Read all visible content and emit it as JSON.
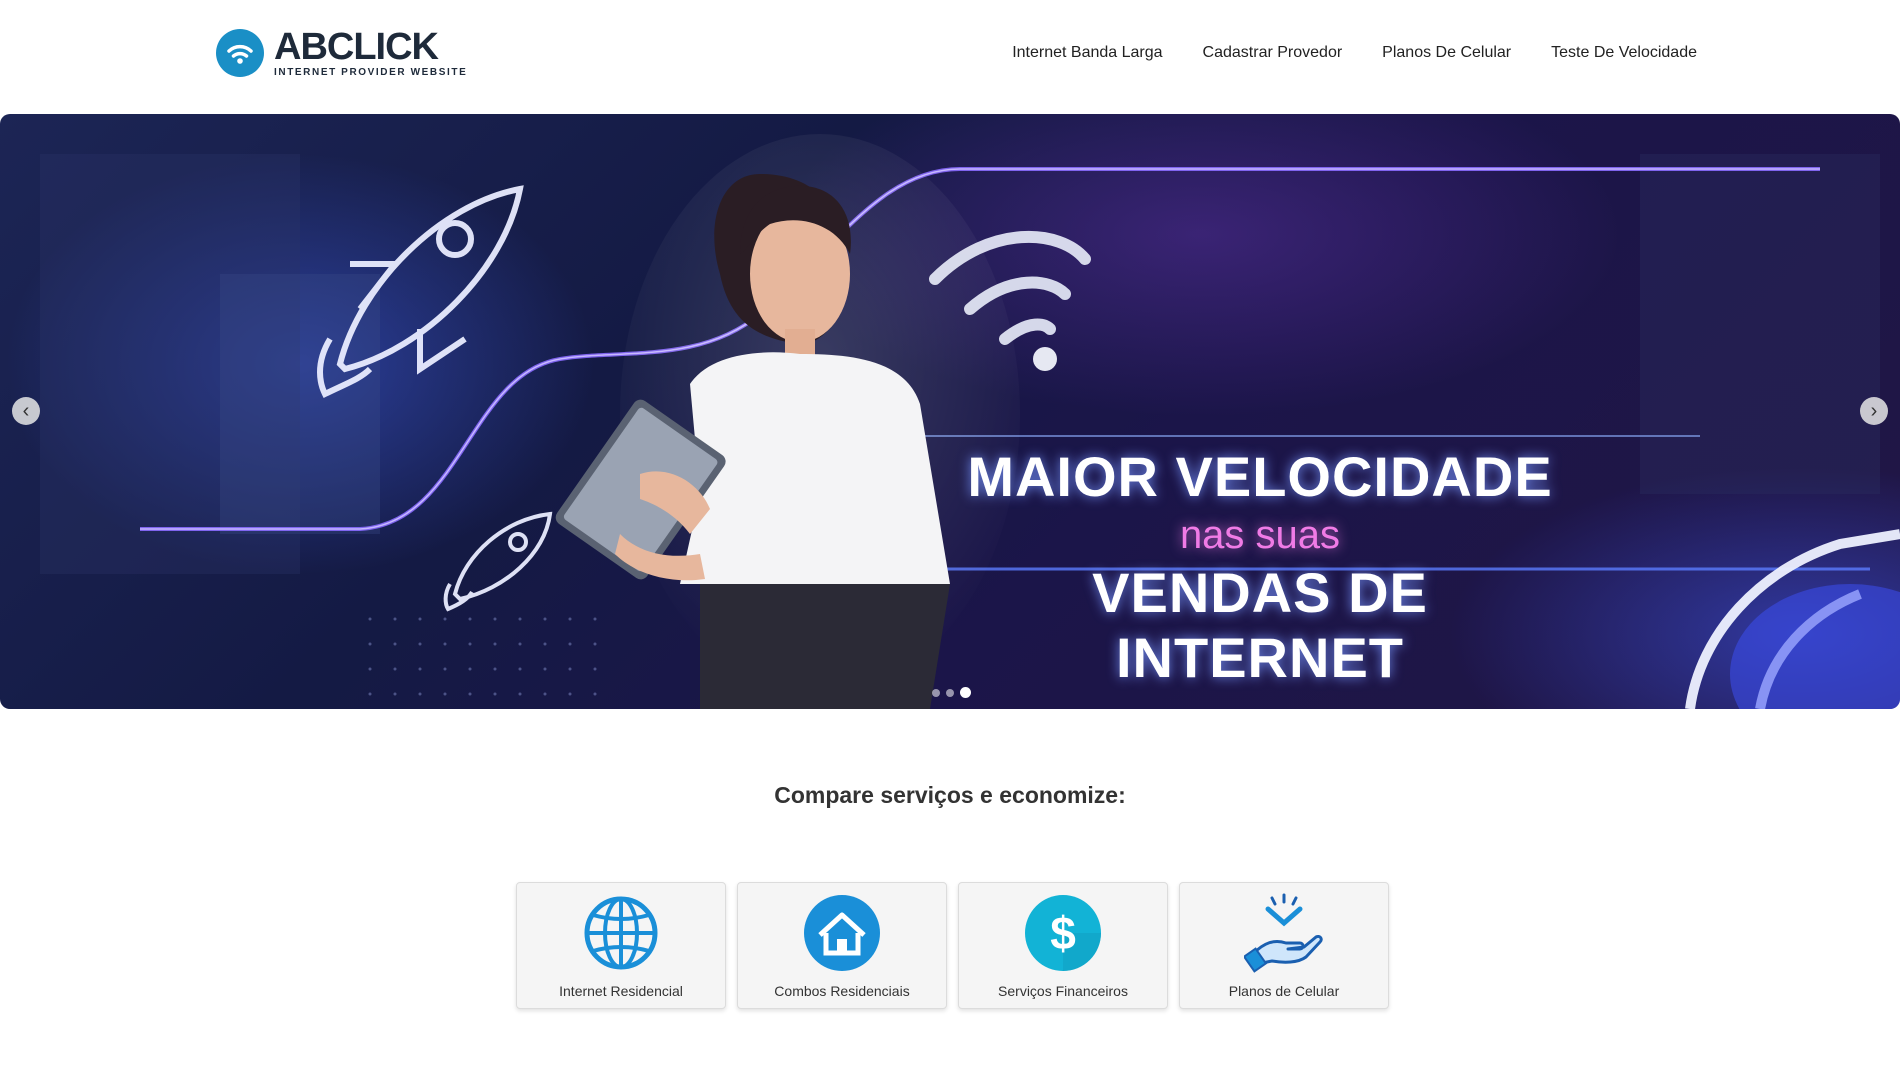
{
  "brand": {
    "name_part1": "AB",
    "name_part2": "CLICK",
    "tagline": "INTERNET PROVIDER WEBSITE",
    "color": "#1a8fc6"
  },
  "nav": {
    "items": [
      {
        "label": "Internet Banda Larga"
      },
      {
        "label": "Cadastrar Provedor"
      },
      {
        "label": "Planos De Celular"
      },
      {
        "label": "Teste De Velocidade"
      }
    ]
  },
  "hero": {
    "line1": "MAIOR VELOCIDADE",
    "line2": "nas suas",
    "line3": "VENDAS DE INTERNET",
    "prev_icon": "chevron-left-icon",
    "next_icon": "chevron-right-icon",
    "slide_count": 3,
    "active_slide": 3
  },
  "services": {
    "title": "Compare serviços e economize:",
    "cards": [
      {
        "label": "Internet Residencial",
        "icon": "globe-icon"
      },
      {
        "label": "Combos Residenciais",
        "icon": "house-icon"
      },
      {
        "label": "Serviços Financeiros",
        "icon": "dollar-icon"
      },
      {
        "label": "Planos de Celular",
        "icon": "hand-phone-icon"
      }
    ]
  },
  "colors": {
    "accent": "#1a8fc6",
    "hero_pink": "#f07be6"
  }
}
